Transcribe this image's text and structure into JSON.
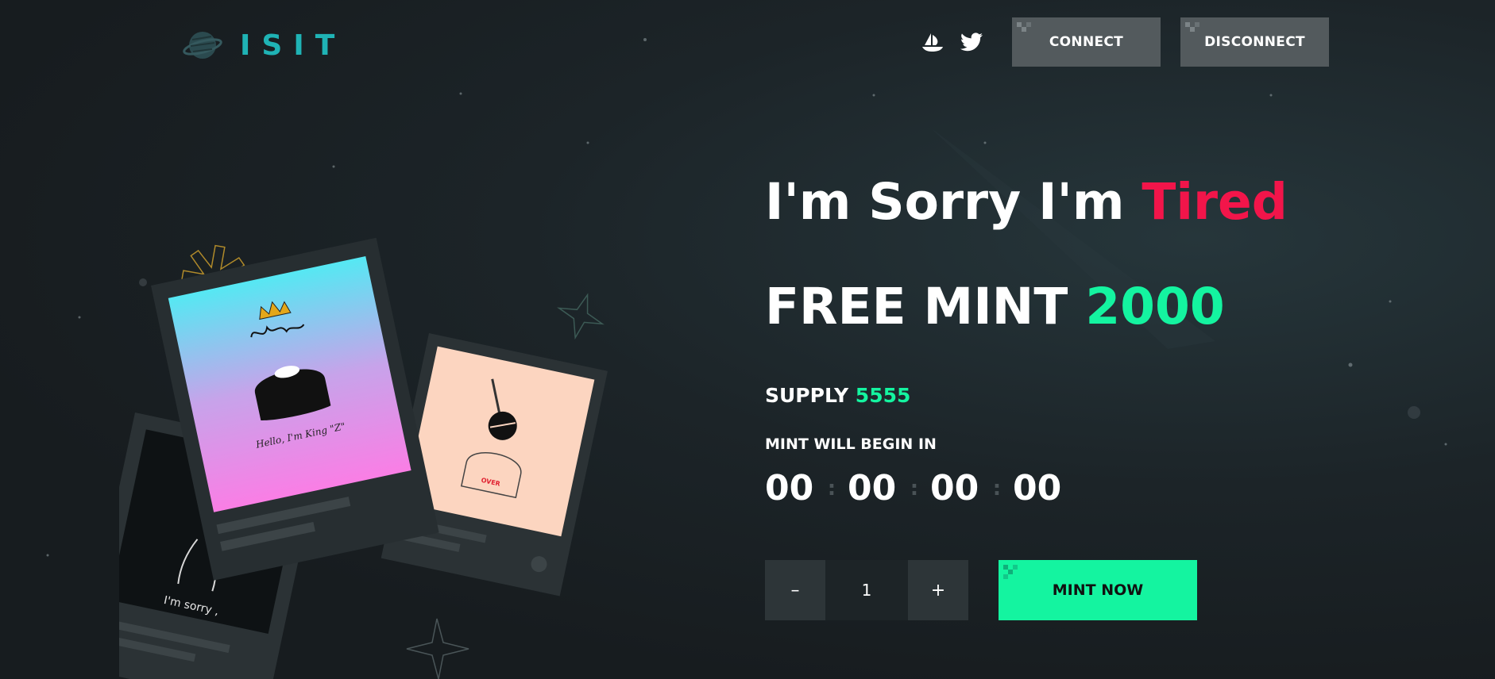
{
  "header": {
    "logo_text": "ISIT",
    "social": [
      "opensea-icon",
      "twitter-icon"
    ],
    "connect_label": "CONNECT",
    "disconnect_label": "DISCONNECT"
  },
  "hero": {
    "title_main": "I'm Sorry I'm ",
    "title_accent": "Tired",
    "mint_main": "FREE MINT ",
    "mint_accent": "2000",
    "supply_label": "SUPPLY ",
    "supply_value": "5555",
    "mint_begin_label": "MINT WILL BEGIN IN",
    "countdown": [
      "00",
      "00",
      "00",
      "00"
    ],
    "countdown_sep": ":",
    "quantity": {
      "minus": "–",
      "value": "1",
      "plus": "+"
    },
    "mint_button": "MINT NOW"
  },
  "art": {
    "card_main_caption": "Hello, I'm King \"Z\"",
    "card_back_caption": "I'm sorry ,",
    "card_right_caption": "OVER"
  },
  "colors": {
    "accent_red": "#f2154a",
    "accent_green": "#14f4a0",
    "logo_teal": "#1fb3b5"
  }
}
